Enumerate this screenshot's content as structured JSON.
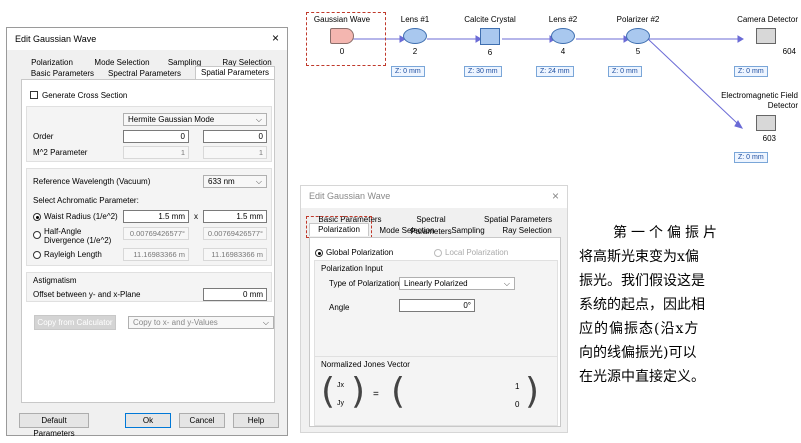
{
  "dialog1": {
    "title": "Edit Gaussian Wave",
    "close": "×",
    "tabs_row1": [
      "Polarization",
      "Mode Selection",
      "Sampling",
      "Ray Selection"
    ],
    "tabs_row2": [
      "Basic Parameters",
      "Spectral Parameters",
      "Spatial Parameters"
    ],
    "generate_cross_section": "Generate Cross Section",
    "mode_select": "Hermite Gaussian Mode",
    "order_label": "Order",
    "order_values": [
      "0",
      "0"
    ],
    "m2_label": "M^2 Parameter",
    "m2_values": [
      "1",
      "1"
    ],
    "ref_wavelength_label": "Reference Wavelength (Vacuum)",
    "ref_wavelength_value": "633 nm",
    "achromatic_label": "Select Achromatic Parameter:",
    "waist_label": "Waist Radius (1/e^2)",
    "waist_values": [
      "1.5 mm",
      "1.5 mm"
    ],
    "x_sep": "x",
    "halfangle_label": "Half-Angle Divergence (1/e^2)",
    "halfangle_values": [
      "0.00769426577°",
      "0.00769426577°"
    ],
    "rayleigh_label": "Rayleigh Length",
    "rayleigh_values": [
      "11.16983366 m",
      "11.16983366 m"
    ],
    "astigmatism_label": "Astigmatism",
    "offset_label": "Offset between y- and x-Plane",
    "offset_value": "0 mm",
    "copy_button": "Copy from Calculator",
    "copy_select": "Copy to x- and y-Values",
    "default_button": "Default Parameters",
    "ok_button": "Ok",
    "cancel_button": "Cancel",
    "help_button": "Help"
  },
  "diagram": {
    "nodes": [
      {
        "name": "Gaussian Wave",
        "id": "0"
      },
      {
        "name": "Lens #1",
        "id": "2",
        "z": "Z: 0 mm"
      },
      {
        "name": "Calcite Crystal",
        "id": "6",
        "z": "Z: 30 mm"
      },
      {
        "name": "Lens #2",
        "id": "4",
        "z": "Z: 24 mm"
      },
      {
        "name": "Polarizer #2",
        "id": "5",
        "z": "Z: 0 mm"
      },
      {
        "name": "Camera Detector",
        "id": "604",
        "z": "Z: 0 mm"
      },
      {
        "name": "Electromagnetic Field Detector",
        "id": "603",
        "z": "Z: 0 mm"
      }
    ]
  },
  "dialog2": {
    "title": "Edit Gaussian Wave",
    "close": "×",
    "tabs_row1": [
      "Basic Parameters",
      "Spectral Parameters",
      "Spatial Parameters"
    ],
    "tabs_row2": [
      "Polarization",
      "Mode Selection",
      "Sampling",
      "Ray Selection"
    ],
    "global_polarization": "Global Polarization",
    "local_polarization": "Local Polarization",
    "polarization_input": "Polarization Input",
    "type_label": "Type of Polarization",
    "type_value": "Linearly Polarized",
    "angle_label": "Angle",
    "angle_value": "0°",
    "jones_label": "Normalized Jones Vector",
    "jx": "Jx",
    "jy": "Jy",
    "equals": "=",
    "jones_values": [
      "1",
      "0"
    ]
  },
  "annotation": {
    "lines": [
      "第一个偏振片",
      "将高斯光束变为x偏",
      "振光。我们假设这是",
      "系统的起点，因此相",
      "应的偏振态(沿x方",
      "向的线偏振光)可以",
      "在光源中直接定义。"
    ]
  },
  "colors": {
    "accent_red": "#c0392b",
    "node_blue": "#a9c8ef",
    "link_purple": "#6b6bd6"
  }
}
